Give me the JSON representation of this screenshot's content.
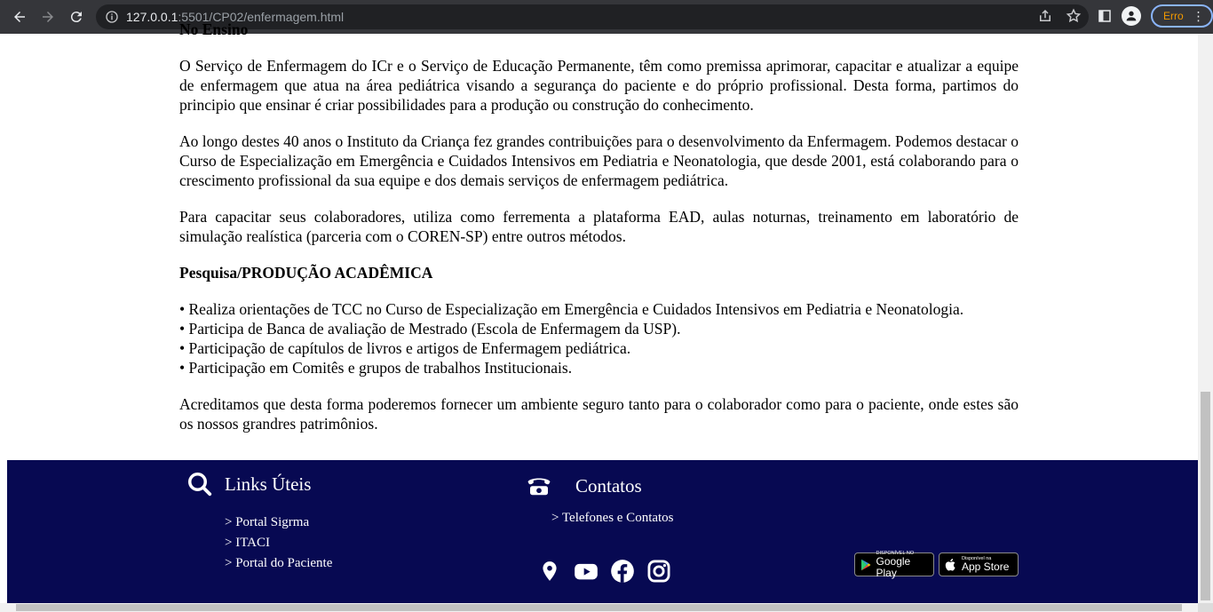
{
  "browser": {
    "url_host": "127.0.0.1",
    "url_rest": ":5501/CP02/enfermagem.html",
    "profile_label": "Erro"
  },
  "content": {
    "clipped_heading": "No Ensino",
    "paragraphs": [
      "O Serviço de Enfermagem do ICr e o Serviço de Educação Permanente, têm como premissa aprimorar, capacitar e atualizar a equipe de enfermagem que atua na área pediátrica visando a segurança do paciente e do próprio profissional. Desta forma, partimos do principio que ensinar é criar possibilidades para a produção ou construção do conhecimento.",
      "Ao longo destes 40 anos o Instituto da Criança fez grandes contribuições para o desenvolvimento da Enfermagem. Podemos destacar o Curso de Especialização em Emergência e Cuidados Intensivos em Pediatria e Neonatologia, que desde 2001, está colaborando para o crescimento profissional da sua equipe e dos demais serviços de enfermagem pediátrica.",
      "Para capacitar seus colaboradores, utiliza como ferrementa a plataforma EAD, aulas noturnas, treinamento em laboratório de simulação realística (parceria com o COREN-SP) entre outros métodos."
    ],
    "research_heading": "Pesquisa/PRODUÇÃO ACADÊMICA",
    "bullets": [
      "• Realiza orientações de TCC no Curso de Especialização em Emergência e Cuidados Intensivos em Pediatria e Neonatologia.",
      "• Participa de Banca de avaliação de Mestrado (Escola de Enfermagem da USP).",
      "• Participação de capítulos de livros e artigos de Enfermagem pediátrica.",
      "• Participação em Comitês e grupos de trabalhos Institucionais."
    ],
    "closing": "Acreditamos que desta forma poderemos fornecer um ambiente seguro tanto para o colaborador como para o paciente, onde estes são os nossos grandres patrimônios."
  },
  "footer": {
    "links_title": "Links Úteis",
    "links": [
      "> Portal Sigrma",
      "> ITACI",
      "> Portal do Paciente"
    ],
    "contacts_title": "Contatos",
    "contacts_link": "> Telefones e Contatos",
    "social_icons": [
      "location-pin-icon",
      "youtube-icon",
      "facebook-icon",
      "instagram-icon"
    ],
    "google_play": {
      "small": "DISPONÍVEL NO",
      "big": "Google Play"
    },
    "app_store": {
      "small": "Disponível na",
      "big": "App Store"
    },
    "background_color": "#070952"
  }
}
